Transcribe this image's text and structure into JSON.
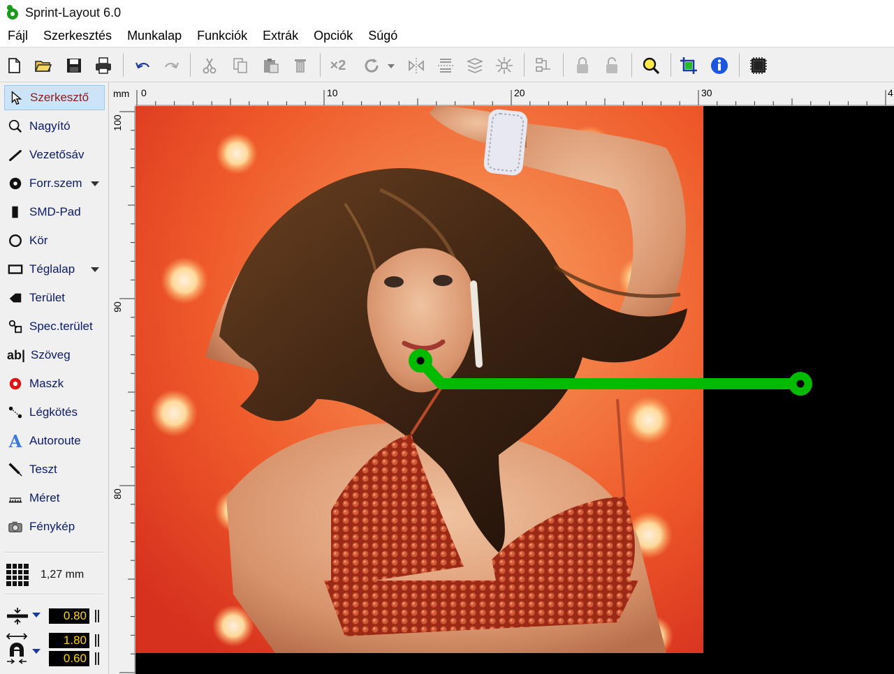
{
  "app": {
    "title": "Sprint-Layout 6.0"
  },
  "menu": {
    "items": [
      "Fájl",
      "Szerkesztés",
      "Munkalap",
      "Funkciók",
      "Extrák",
      "Opciók",
      "Súgó"
    ]
  },
  "toolbar": {
    "buttons": [
      {
        "name": "new",
        "icon": "new-document-icon"
      },
      {
        "name": "open",
        "icon": "open-folder-icon"
      },
      {
        "name": "save",
        "icon": "save-disk-icon"
      },
      {
        "name": "print",
        "icon": "printer-icon"
      },
      {
        "name": "undo",
        "icon": "undo-icon"
      },
      {
        "name": "redo",
        "icon": "redo-icon"
      },
      {
        "name": "cut",
        "icon": "cut-icon"
      },
      {
        "name": "copy",
        "icon": "copy-icon"
      },
      {
        "name": "paste",
        "icon": "paste-icon"
      },
      {
        "name": "delete",
        "icon": "trash-icon"
      },
      {
        "name": "duplicate",
        "icon": "duplicate-icon",
        "text": "×2"
      },
      {
        "name": "rotate",
        "icon": "rotate-icon"
      },
      {
        "name": "mirror-h",
        "icon": "mirror-horizontal-icon"
      },
      {
        "name": "mirror-v",
        "icon": "mirror-vertical-icon"
      },
      {
        "name": "align",
        "icon": "align-icon"
      },
      {
        "name": "snap",
        "icon": "snap-icon"
      },
      {
        "name": "group",
        "icon": "group-icon"
      },
      {
        "name": "lock",
        "icon": "lock-icon"
      },
      {
        "name": "unlock",
        "icon": "unlock-icon"
      },
      {
        "name": "zoom",
        "icon": "zoom-magnifier-icon"
      },
      {
        "name": "crop",
        "icon": "crop-icon"
      },
      {
        "name": "info",
        "icon": "info-icon"
      },
      {
        "name": "chip",
        "icon": "chip-icon"
      }
    ]
  },
  "tools": [
    {
      "label": "Szerkesztő",
      "icon": "cursor-arrow-icon",
      "active": true
    },
    {
      "label": "Nagyító",
      "icon": "magnifier-icon"
    },
    {
      "label": "Vezetősáv",
      "icon": "track-line-icon"
    },
    {
      "label": "Forr.szem",
      "icon": "pad-ring-icon",
      "dropdown": true
    },
    {
      "label": "SMD-Pad",
      "icon": "smd-pad-icon"
    },
    {
      "label": "Kör",
      "icon": "circle-icon"
    },
    {
      "label": "Téglalap",
      "icon": "rectangle-icon",
      "dropdown": true
    },
    {
      "label": "Terület",
      "icon": "area-icon"
    },
    {
      "label": "Spec.terület",
      "icon": "special-area-icon"
    },
    {
      "label": "Szöveg",
      "icon": "text-icon",
      "icon_text": "ab|"
    },
    {
      "label": "Maszk",
      "icon": "mask-icon"
    },
    {
      "label": "Légkötés",
      "icon": "airwire-icon"
    },
    {
      "label": "Autoroute",
      "icon": "autoroute-icon",
      "icon_text": "A"
    },
    {
      "label": "Teszt",
      "icon": "test-probe-icon"
    },
    {
      "label": "Méret",
      "icon": "measure-icon"
    },
    {
      "label": "Fénykép",
      "icon": "camera-icon"
    }
  ],
  "grid": {
    "value": "1,27 mm",
    "icon": "grid-icon"
  },
  "track_width": {
    "value": "0.80",
    "icon": "track-width-icon"
  },
  "pad_size": {
    "outer": "1.80",
    "inner": "0.60",
    "icon": "pad-size-icon"
  },
  "ruler": {
    "unit": "mm",
    "top_labels": [
      "0",
      "10",
      "20",
      "30",
      "4"
    ],
    "left_labels": [
      "100",
      "90",
      "80"
    ]
  },
  "colors": {
    "track": "#00bb00",
    "canvas": "#000000",
    "active_tool_bg": "#cce4f7",
    "value_text": "#ffd400"
  },
  "canvas_content": {
    "photo": "woman-photo-background",
    "track": {
      "pads": 2,
      "segments": 2
    }
  }
}
